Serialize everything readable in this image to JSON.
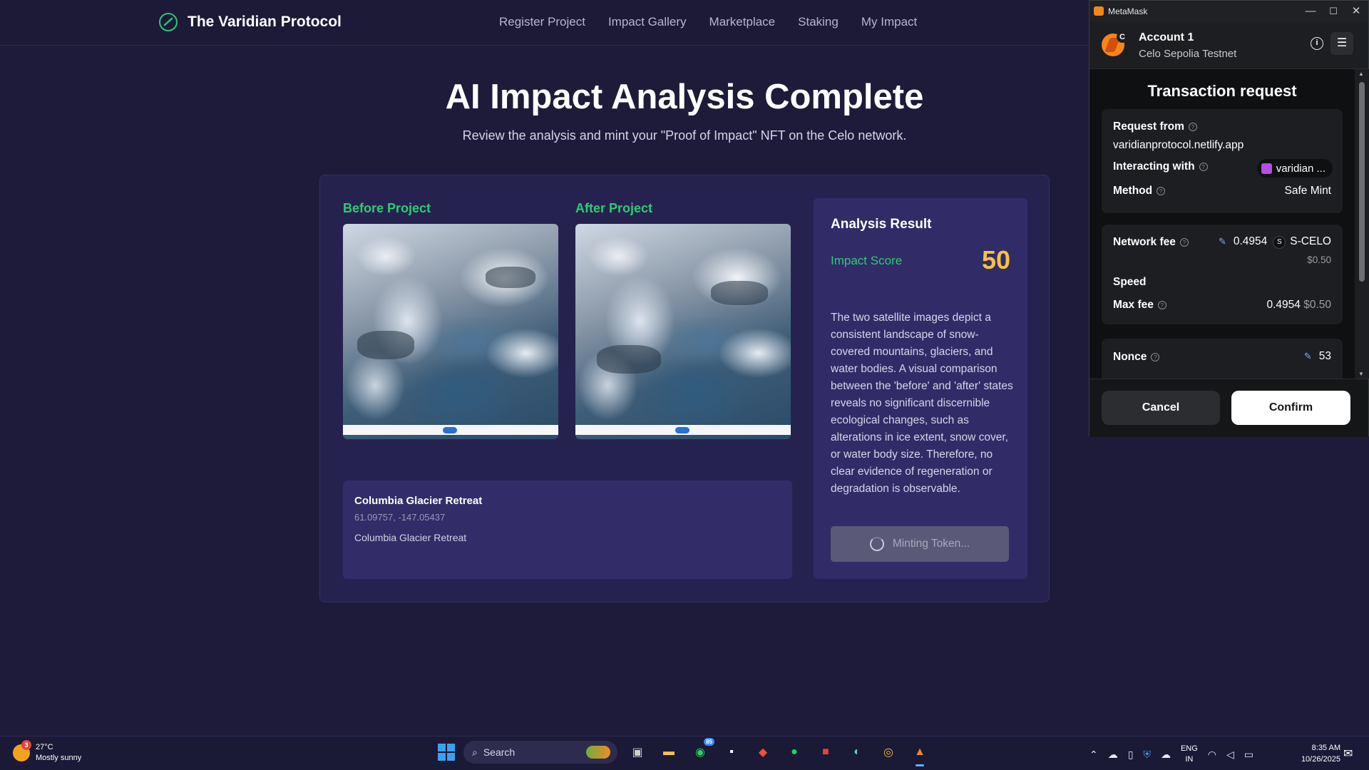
{
  "site": {
    "brand": "The Varidian Protocol",
    "nav": [
      "Register Project",
      "Impact Gallery",
      "Marketplace",
      "Staking",
      "My Impact"
    ]
  },
  "hero": {
    "title": "AI Impact Analysis Complete",
    "subtitle": "Review the analysis and mint your \"Proof of Impact\" NFT on the Celo network."
  },
  "images": {
    "before_label": "Before Project",
    "after_label": "After Project"
  },
  "location": {
    "title": "Columbia Glacier Retreat",
    "coords": "61.09757, -147.05437",
    "description": "Columbia Glacier Retreat"
  },
  "analysis": {
    "title": "Analysis Result",
    "score_label": "Impact Score",
    "score": "50",
    "score_color": "#f5c242",
    "text": "The two satellite images depict a consistent landscape of snow-covered mountains, glaciers, and water bodies. A visual comparison between the 'before' and 'after' states reveals no significant discernible ecological changes, such as alterations in ice extent, snow cover, or water body size. Therefore, no clear evidence of regeneration or degradation is observable.",
    "mint_button": "Minting Token..."
  },
  "metamask": {
    "window_title": "MetaMask",
    "account_name": "Account 1",
    "account_badge": "C",
    "network": "Celo Sepolia Testnet",
    "heading": "Transaction request",
    "request_from_label": "Request from",
    "origin": "varidianprotocol.netlify.app",
    "interacting_label": "Interacting with",
    "contract": "varidian ...",
    "method_label": "Method",
    "method": "Safe Mint",
    "network_fee_label": "Network fee",
    "network_fee": "0.4954",
    "token_symbol": "S-CELO",
    "token_icon_letter": "S",
    "network_fee_fiat": "$0.50",
    "speed_label": "Speed",
    "max_fee_label": "Max fee",
    "max_fee": "0.4954",
    "max_fee_fiat": "$0.50",
    "nonce_label": "Nonce",
    "nonce": "53",
    "cancel": "Cancel",
    "confirm": "Confirm",
    "win_controls": [
      "—",
      "☐",
      "✕"
    ]
  },
  "taskbar": {
    "weather_temp": "27°C",
    "weather_desc": "Mostly sunny",
    "weather_badge": "3",
    "search_placeholder": "Search",
    "whatsapp_badge": "85",
    "lang_1": "ENG",
    "lang_2": "IN",
    "time": "8:35 AM",
    "date": "10/26/2025"
  },
  "colors": {
    "accent_green": "#2ecc71",
    "score_gold": "#f5c242",
    "page_bg": "#1e1b3a"
  }
}
